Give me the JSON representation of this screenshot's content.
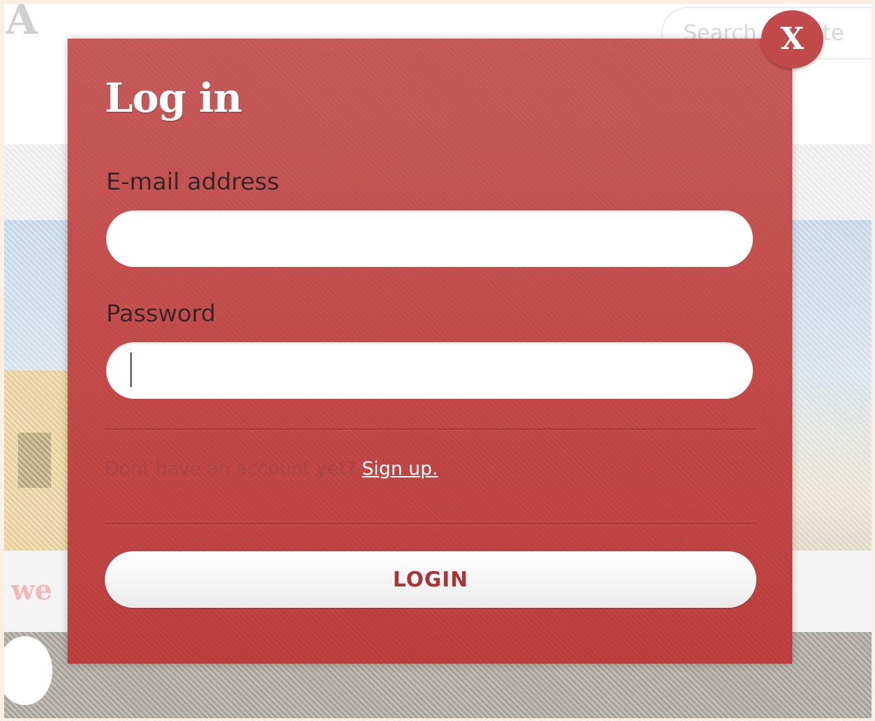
{
  "background_page": {
    "logo_fragment": "A",
    "search_placeholder": "Search the site",
    "welcome_fragment": "we"
  },
  "modal": {
    "title": "Log in",
    "close_label": "X",
    "email": {
      "label": "E-mail address",
      "value": ""
    },
    "password": {
      "label": "Password",
      "value": ""
    },
    "signup_prompt": "Dont have an account yet?",
    "signup_link": "Sign up.",
    "login_button": "LOGIN"
  },
  "colors": {
    "modal_background": "#c04847",
    "login_text": "#a93535",
    "page_border": "#fbeee2"
  },
  "icons": {
    "close": "close-icon"
  }
}
